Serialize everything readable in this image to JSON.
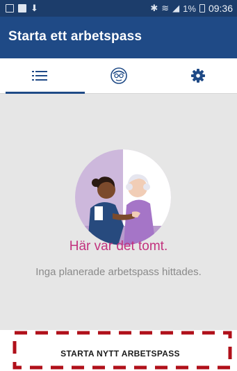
{
  "status_bar": {
    "notification_icons": [
      "screen-icon",
      "p-badge-icon",
      "download-icon"
    ],
    "system_icons": [
      "bluetooth-icon",
      "wifi-icon",
      "signal-icon"
    ],
    "battery": "1%",
    "time": "09:36"
  },
  "app_bar": {
    "title": "Starta ett arbetspass"
  },
  "tabs": [
    {
      "icon": "list-icon",
      "selected": true
    },
    {
      "icon": "nurse-face-icon",
      "selected": false
    },
    {
      "icon": "gear-icon",
      "selected": false
    }
  ],
  "empty_state": {
    "title": "Här var det tomt.",
    "subtitle": "Inga planerade arbetspass hittades."
  },
  "bottom": {
    "start_button_label": "STARTA NYTT ARBETSPASS"
  },
  "colors": {
    "status_bar": "#1c3d6b",
    "app_bar": "#1f4a86",
    "accent_pink": "#c2327e",
    "highlight_dashes": "#b0101a",
    "content_bg": "#e6e6e6"
  }
}
